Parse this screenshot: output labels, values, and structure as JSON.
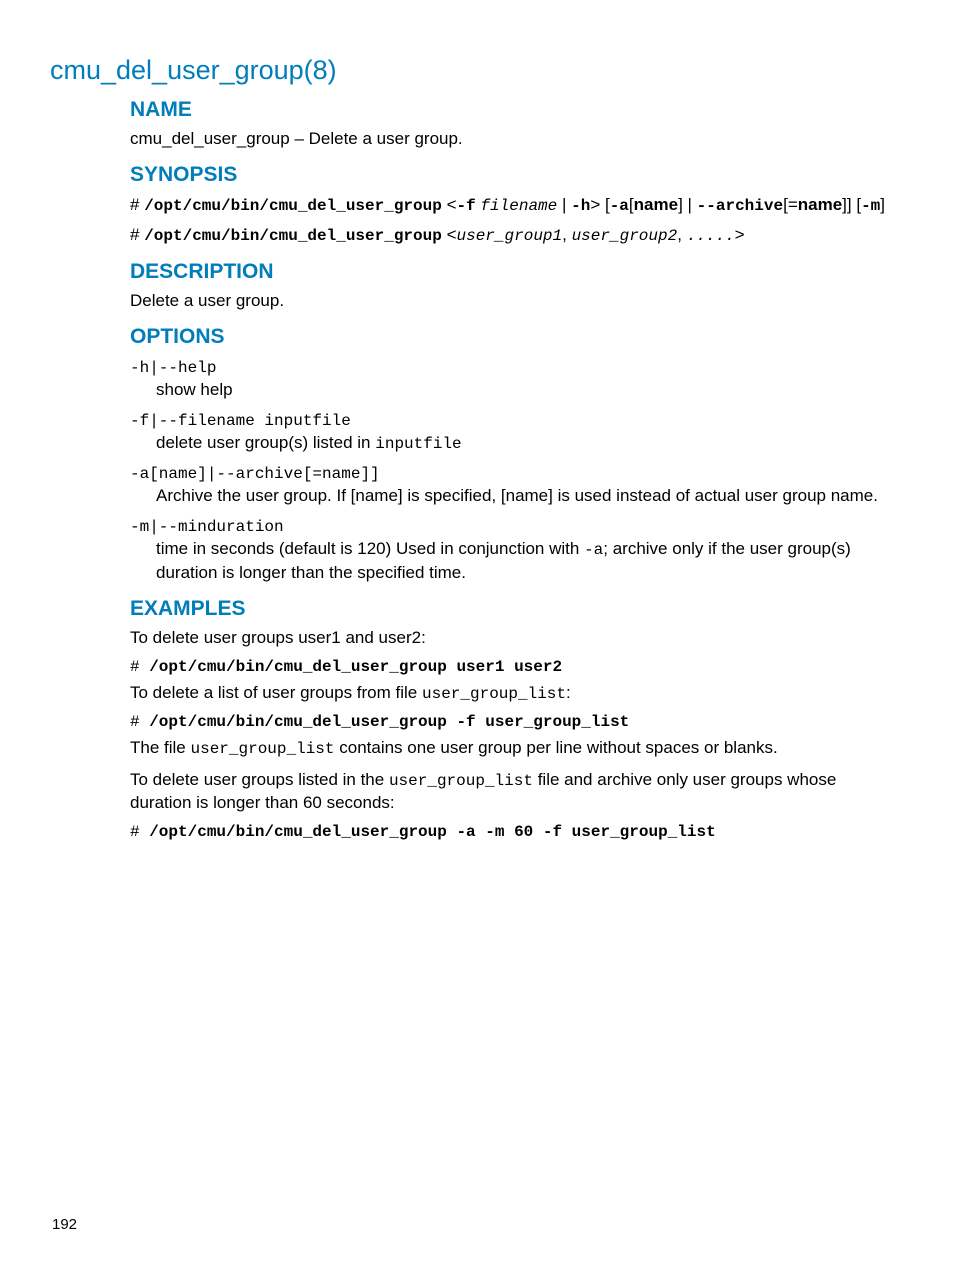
{
  "page_title": "cmu_del_user_group(8)",
  "headings": {
    "name": "NAME",
    "synopsis": "SYNOPSIS",
    "description": "DESCRIPTION",
    "options": "OPTIONS",
    "examples": "EXAMPLES"
  },
  "name_text": "cmu_del_user_group – Delete a user group.",
  "synopsis": {
    "line1": {
      "hash": "# ",
      "cmd": "/opt/cmu/bin/cmu_del_user_group",
      "lt": " <",
      "fflag": "-f",
      "sp1": " ",
      "filename": "filename",
      "pipe": " | ",
      "hflag": "-h",
      "gt": "> [",
      "aflag": "-a",
      "brname": "[",
      "name": "name",
      "br2": "]",
      "pipearch": " | ",
      "archive": "--archive",
      "archeq": "[=",
      "archname": "name",
      "archend": "]] [",
      "mflag": "-m",
      "end": "]"
    },
    "line2": {
      "hash": "# ",
      "cmd": "/opt/cmu/bin/cmu_del_user_group",
      "sp": " <",
      "ug1": "user_group1",
      "c1": ", ",
      "ug2": "user_group2",
      "c2": ", ",
      "dots": ".....",
      "end": ">"
    }
  },
  "description_text": "Delete a user group.",
  "options": {
    "help": {
      "term": "-h|--help",
      "desc": "show help"
    },
    "file": {
      "term": "-f|--filename inputfile",
      "desc_pre": "delete user group(s) listed in ",
      "desc_code": "inputfile"
    },
    "archive": {
      "term": "-a[name]|--archive[=name]]",
      "desc": "Archive the user group. If [name] is specified, [name] is used instead of actual user group name."
    },
    "mindur": {
      "term": "-m|--minduration",
      "desc_pre": "time in seconds (default is 120) Used in conjunction with ",
      "desc_code": "-a",
      "desc_post": "; archive only if the user group(s) duration is longer than the specified time."
    }
  },
  "examples": {
    "intro1": "To delete user groups user1 and user2:",
    "cmd1_hash": "# ",
    "cmd1": "/opt/cmu/bin/cmu_del_user_group user1 user2",
    "intro2_pre": "To delete a list of user groups from file ",
    "intro2_code": "user_group_list",
    "intro2_post": ":",
    "cmd2_hash": "# ",
    "cmd2": "/opt/cmu/bin/cmu_del_user_group -f user_group_list",
    "note_pre": "The file ",
    "note_code": "user_group_list",
    "note_post": " contains one user group per line without spaces or blanks.",
    "intro3_pre": "To delete user groups listed in the ",
    "intro3_code": "user_group_list",
    "intro3_post": " file and archive only user groups whose duration is longer than 60 seconds:",
    "cmd3_hash": "# ",
    "cmd3": "/opt/cmu/bin/cmu_del_user_group -a -m 60 -f user_group_list"
  },
  "page_number": "192"
}
